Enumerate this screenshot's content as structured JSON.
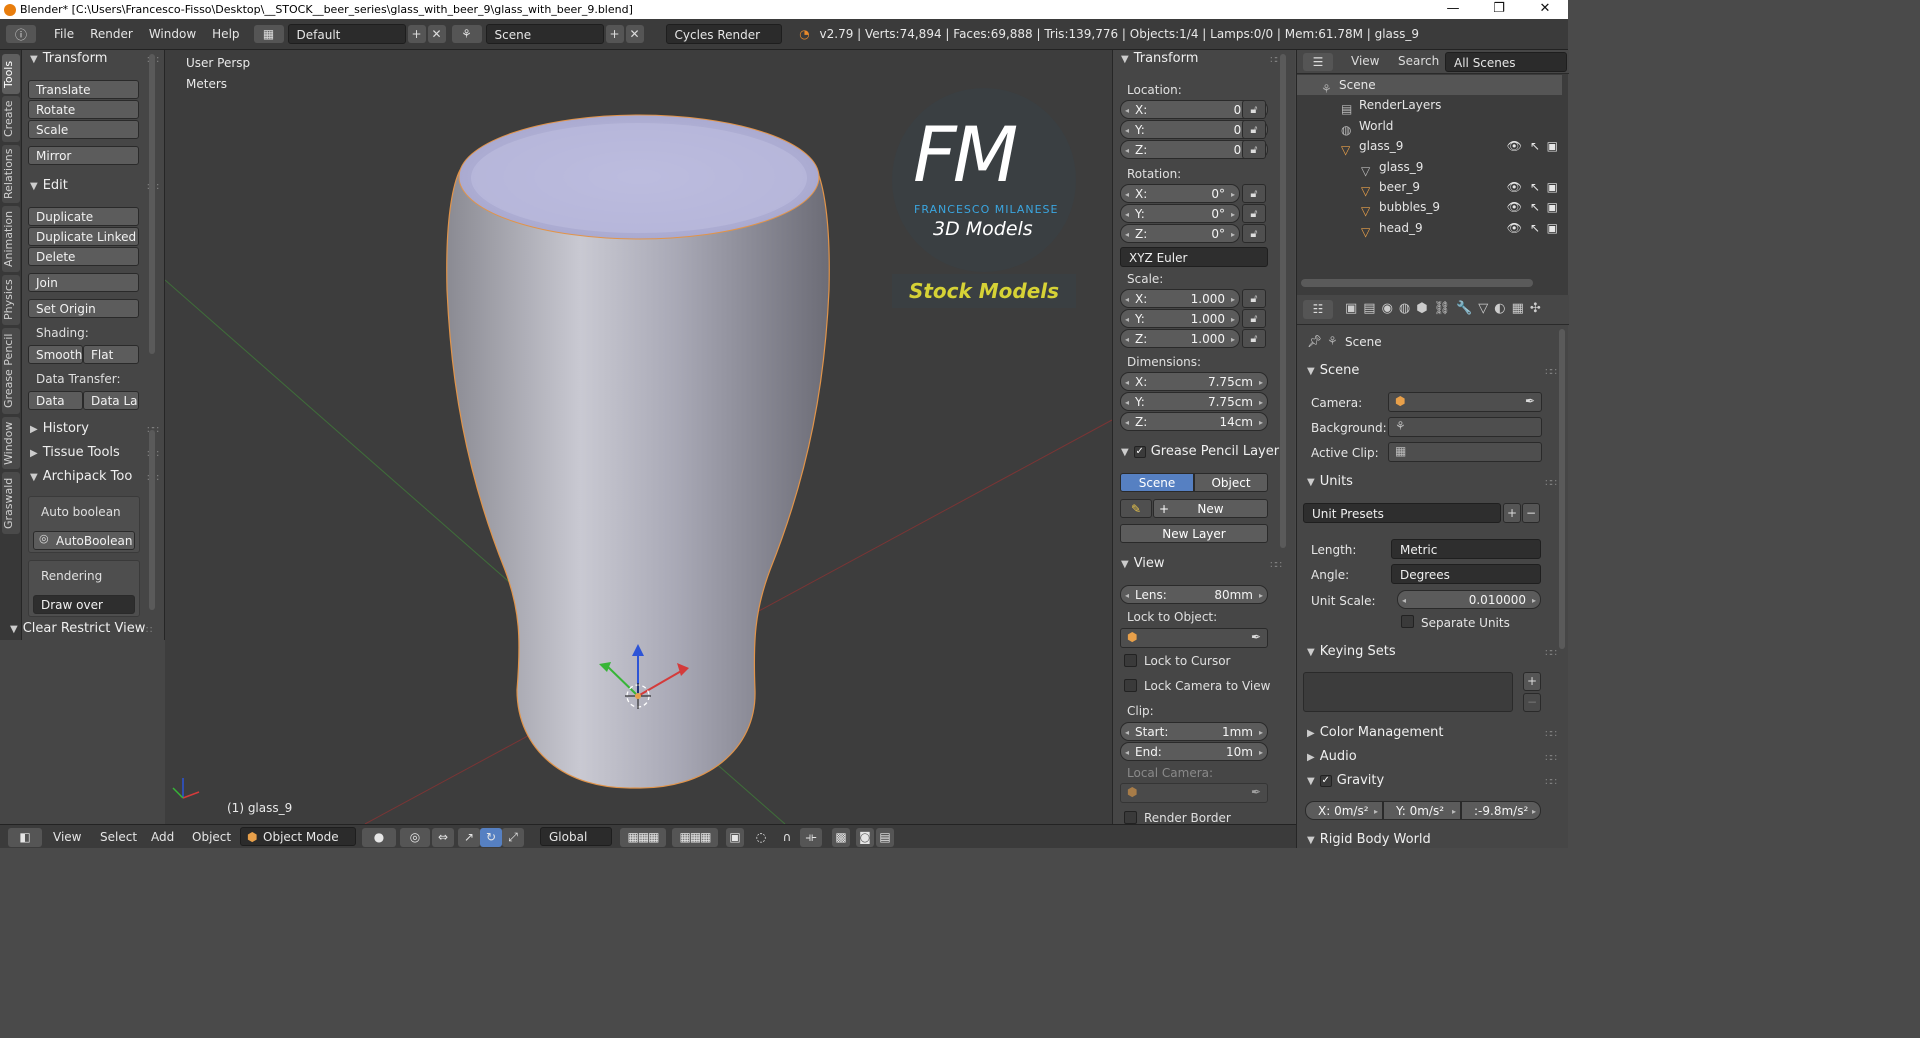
{
  "window": {
    "title": "Blender* [C:\\Users\\Francesco-Fisso\\Desktop\\__STOCK__beer_series\\glass_with_beer_9\\glass_with_beer_9.blend]",
    "controls": [
      "—",
      "❐",
      "✕"
    ]
  },
  "topbar": {
    "menus": [
      "File",
      "Render",
      "Window",
      "Help"
    ],
    "layout": "Default",
    "scene": "Scene",
    "engine": "Cycles Render",
    "stats": "v2.79 | Verts:74,894 | Faces:69,888 | Tris:139,776 | Objects:1/4 | Lamps:0/0 | Mem:61.78M | glass_9"
  },
  "lefttabs": [
    "Tools",
    "Create",
    "Relations",
    "Animation",
    "Physics",
    "Grease Pencil",
    "Window",
    "Graswald"
  ],
  "toolshelf": {
    "transform_title": "Transform",
    "translate": "Translate",
    "rotate": "Rotate",
    "scale": "Scale",
    "mirror": "Mirror",
    "edit_title": "Edit",
    "duplicate": "Duplicate",
    "duplicate_linked": "Duplicate Linked",
    "delete": "Delete",
    "join": "Join",
    "set_origin": "Set Origin",
    "shading_label": "Shading:",
    "smooth": "Smooth",
    "flat": "Flat",
    "data_transfer_label": "Data Transfer:",
    "data": "Data",
    "data_la": "Data La",
    "history": "History",
    "tissue_tools": "Tissue Tools",
    "archipack_tools": "Archipack Too",
    "auto_boolean_label": "Auto boolean",
    "auto_boolean_btn": "AutoBoolean",
    "rendering_label": "Rendering",
    "draw_over": "Draw over",
    "clear_restrict": "Clear Restrict View"
  },
  "viewport": {
    "view_name": "User Persp",
    "units": "Meters",
    "object_label": "(1) glass_9",
    "watermark": {
      "initials": "FM",
      "name": "FRANCESCO MILANESE",
      "sub": "3D Models",
      "banner": "Stock Models"
    }
  },
  "npanel": {
    "transform_title": "Transform",
    "location_label": "Location:",
    "location": [
      {
        "k": "X:",
        "v": "0m"
      },
      {
        "k": "Y:",
        "v": "0m"
      },
      {
        "k": "Z:",
        "v": "0m"
      }
    ],
    "rotation_label": "Rotation:",
    "rotation": [
      {
        "k": "X:",
        "v": "0°"
      },
      {
        "k": "Y:",
        "v": "0°"
      },
      {
        "k": "Z:",
        "v": "0°"
      }
    ],
    "rotation_mode": "XYZ Euler",
    "scale_label": "Scale:",
    "scale": [
      {
        "k": "X:",
        "v": "1.000"
      },
      {
        "k": "Y:",
        "v": "1.000"
      },
      {
        "k": "Z:",
        "v": "1.000"
      }
    ],
    "dimensions_label": "Dimensions:",
    "dimensions": [
      {
        "k": "X:",
        "v": "7.75cm"
      },
      {
        "k": "Y:",
        "v": "7.75cm"
      },
      {
        "k": "Z:",
        "v": "14cm"
      }
    ],
    "gp_layer": "Grease Pencil Layer",
    "gp_scene": "Scene",
    "gp_object": "Object",
    "gp_new": "New",
    "gp_new_layer": "New Layer",
    "view_title": "View",
    "lens_k": "Lens:",
    "lens_v": "80mm",
    "lock_to_object": "Lock to Object:",
    "lock_to_cursor": "Lock to Cursor",
    "lock_camera": "Lock Camera to View",
    "clip_label": "Clip:",
    "clip_start_k": "Start:",
    "clip_start_v": "1mm",
    "clip_end_k": "End:",
    "clip_end_v": "10m",
    "local_camera": "Local Camera:",
    "render_border": "Render Border"
  },
  "outliner": {
    "view": "View",
    "search": "Search",
    "filter": "All Scenes",
    "rows": [
      "Scene",
      "RenderLayers",
      "World",
      "glass_9",
      "glass_9",
      "beer_9",
      "bubbles_9",
      "head_9"
    ]
  },
  "props": {
    "context": "Scene",
    "scene_title": "Scene",
    "camera": "Camera:",
    "background": "Background:",
    "active_clip": "Active Clip:",
    "units_title": "Units",
    "unit_presets": "Unit Presets",
    "length_k": "Length:",
    "length_v": "Metric",
    "angle_k": "Angle:",
    "angle_v": "Degrees",
    "unit_scale_k": "Unit Scale:",
    "unit_scale_v": "0.010000",
    "separate_units": "Separate Units",
    "keying_sets": "Keying Sets",
    "color_management": "Color Management",
    "audio": "Audio",
    "gravity": "Gravity",
    "gx": "X:  0m/s²",
    "gy": "Y:  0m/s²",
    "gz": ":-9.8m/s²",
    "rigid_body": "Rigid Body World"
  },
  "bottombar": {
    "view": "View",
    "select": "Select",
    "add": "Add",
    "object": "Object",
    "mode": "Object Mode",
    "orientation": "Global"
  }
}
